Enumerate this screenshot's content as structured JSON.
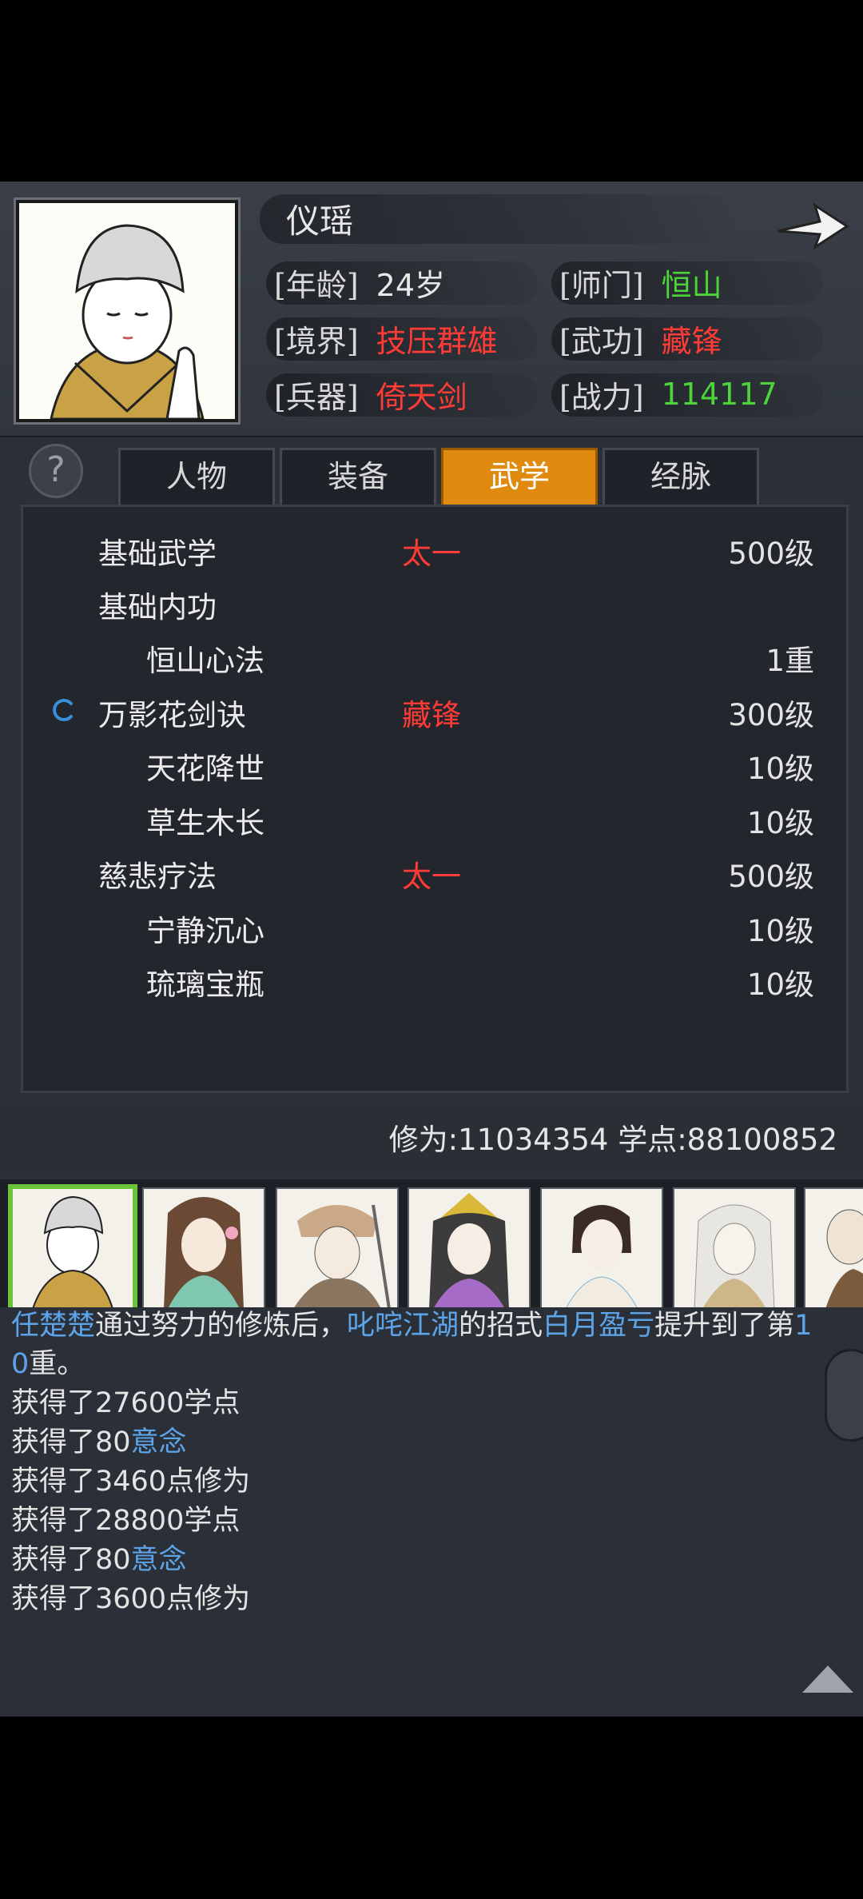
{
  "character": {
    "name": "仪瑶",
    "age_label": "[年龄]",
    "age": "24岁",
    "sect_label": "[师门]",
    "sect": "恒山",
    "realm_label": "[境界]",
    "realm": "技压群雄",
    "martial_label": "[武功]",
    "martial": "藏锋",
    "weapon_label": "[兵器]",
    "weapon": "倚天剑",
    "power_label": "[战力]",
    "power": "114117"
  },
  "help_label": "?",
  "tabs": [
    {
      "label": "人物"
    },
    {
      "label": "装备"
    },
    {
      "label": "武学",
      "active": true
    },
    {
      "label": "经脉"
    }
  ],
  "skills": [
    {
      "name": "基础武学",
      "rank": "太一",
      "level": "500级",
      "indent": false
    },
    {
      "name": "基础内功",
      "rank": "",
      "level": "",
      "indent": false
    },
    {
      "name": "恒山心法",
      "rank": "",
      "level": "1重",
      "indent": true
    },
    {
      "name": "万影花剑诀",
      "rank": "藏锋",
      "level": "300级",
      "indent": false,
      "active": true
    },
    {
      "name": "天花降世",
      "rank": "",
      "level": "10级",
      "indent": true
    },
    {
      "name": "草生木长",
      "rank": "",
      "level": "10级",
      "indent": true
    },
    {
      "name": "慈悲疗法",
      "rank": "太一",
      "level": "500级",
      "indent": false
    },
    {
      "name": "宁静沉心",
      "rank": "",
      "level": "10级",
      "indent": true
    },
    {
      "name": "琉璃宝瓶",
      "rank": "",
      "level": "10级",
      "indent": true
    }
  ],
  "points": "修为:11034354  学点:88100852",
  "log": {
    "first_line": [
      {
        "text": "任楚楚",
        "color": "blue"
      },
      {
        "text": "通过努力的修炼后，",
        "color": "white"
      },
      {
        "text": "叱咤江湖",
        "color": "blue"
      },
      {
        "text": "的招式",
        "color": "white"
      },
      {
        "text": "白月盈亏",
        "color": "blue"
      },
      {
        "text": "提升到了第",
        "color": "white"
      },
      {
        "text": "1",
        "color": "blue"
      }
    ],
    "second_line": [
      {
        "text": "0",
        "color": "blue"
      },
      {
        "text": "重。",
        "color": "white"
      }
    ],
    "lines": [
      [
        {
          "text": "获得了27600学点",
          "color": "white"
        }
      ],
      [
        {
          "text": "获得了80",
          "color": "white"
        },
        {
          "text": "意念",
          "color": "blue"
        }
      ],
      [
        {
          "text": "获得了3460点修为",
          "color": "white"
        }
      ],
      [
        {
          "text": "获得了28800学点",
          "color": "white"
        }
      ],
      [
        {
          "text": "获得了80",
          "color": "white"
        },
        {
          "text": "意念",
          "color": "blue"
        }
      ],
      [
        {
          "text": "获得了3600点修为",
          "color": "white"
        }
      ]
    ]
  },
  "colors": {
    "accent": "#e08a10",
    "red": "#ff3b36",
    "green": "#4cd43a",
    "blue": "#5da3e8",
    "selected": "#6cc33a"
  }
}
